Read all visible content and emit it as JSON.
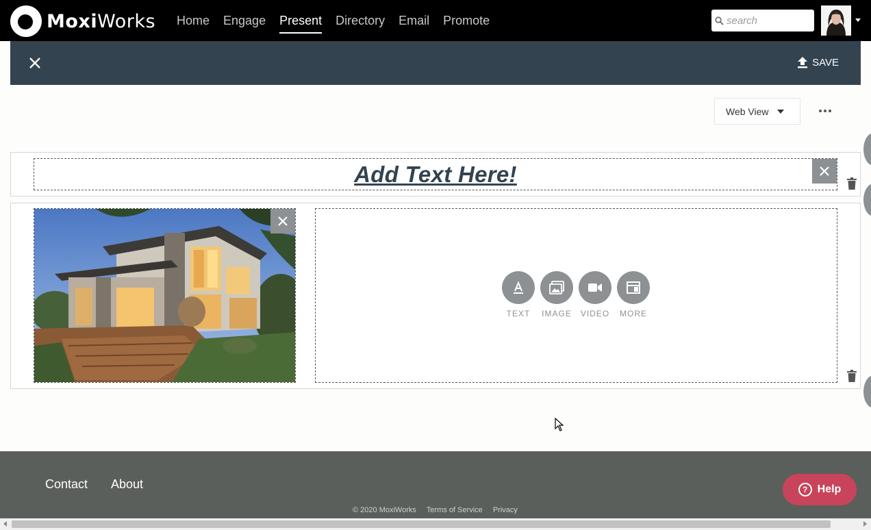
{
  "brand": {
    "name_prefix": "Moxi",
    "name_suffix": "Works"
  },
  "nav": {
    "links": [
      {
        "label": "Home"
      },
      {
        "label": "Engage"
      },
      {
        "label": "Present"
      },
      {
        "label": "Directory"
      },
      {
        "label": "Email"
      },
      {
        "label": "Promote"
      }
    ],
    "active": "Present",
    "search_placeholder": "search"
  },
  "toolbar": {
    "save_label": "SAVE"
  },
  "view": {
    "selected": "Web View"
  },
  "content": {
    "heading": "Add Text Here!",
    "add_buttons": [
      {
        "label": "TEXT",
        "icon": "text-icon"
      },
      {
        "label": "IMAGE",
        "icon": "image-icon"
      },
      {
        "label": "VIDEO",
        "icon": "video-icon"
      },
      {
        "label": "MORE",
        "icon": "layout-icon"
      }
    ]
  },
  "footer": {
    "links": [
      {
        "label": "Contact"
      },
      {
        "label": "About"
      }
    ],
    "copyright": "© 2020 MoxiWorks",
    "terms": "Terms of Service",
    "privacy": "Privacy"
  },
  "help": {
    "label": "Help"
  },
  "colors": {
    "nav_bg": "#000000",
    "toolbar_bg": "#33434f",
    "footer_bg": "#5b5f5b",
    "help_bg": "#c8445a",
    "button_grey": "#8d9194"
  }
}
